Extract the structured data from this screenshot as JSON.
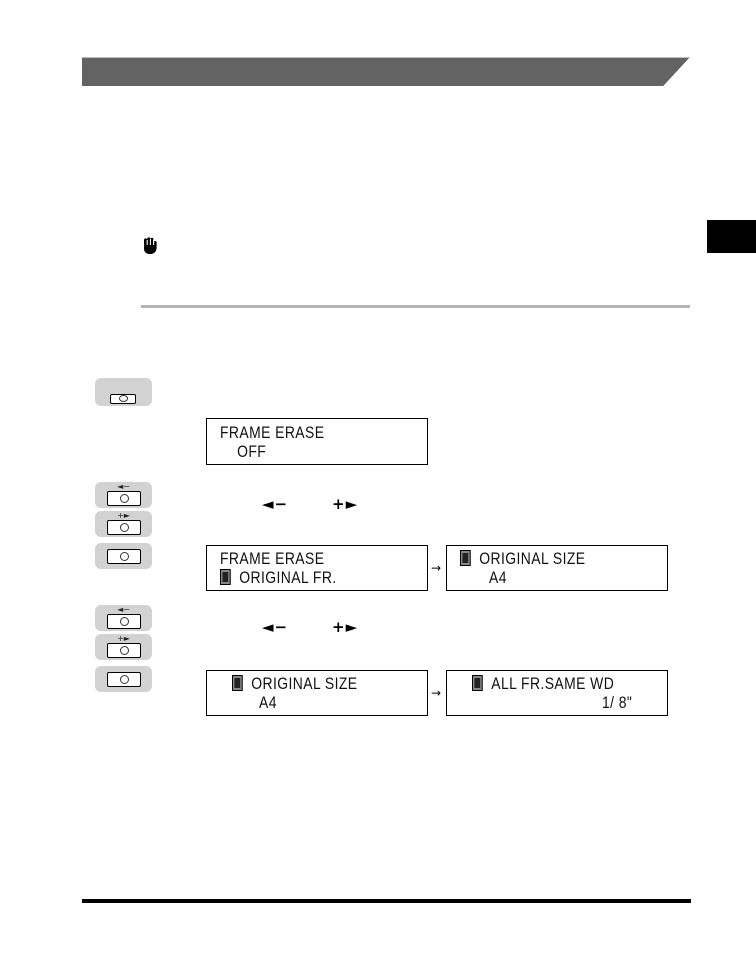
{
  "header": {
    "title": ""
  },
  "chapter_tab": {
    "label": ""
  },
  "notice": {
    "icon": "important-hand-icon"
  },
  "steps": [
    {
      "key": {
        "name": "special-features-key",
        "label": ""
      },
      "display": {
        "line1": "FRAME ERASE",
        "line2": "    OFF"
      }
    },
    {
      "keys": [
        {
          "name": "left-minus-key",
          "label": "◄−"
        },
        {
          "name": "plus-right-key",
          "label": "+►"
        },
        {
          "name": "ok-key",
          "label": ""
        }
      ],
      "inline_keys": {
        "left": "◄−",
        "right": "+►"
      },
      "displays": [
        {
          "line1": "FRAME ERASE",
          "line2": "ORIGINAL FR.",
          "has_pattern_line2": true
        },
        {
          "line1": "ORIGINAL SIZE",
          "line2": "A4",
          "has_pattern_line1": true
        }
      ],
      "arrow": "→"
    },
    {
      "keys": [
        {
          "name": "left-minus-key",
          "label": "◄−"
        },
        {
          "name": "plus-right-key",
          "label": "+►"
        },
        {
          "name": "ok-key",
          "label": ""
        }
      ],
      "inline_keys": {
        "left": "◄−",
        "right": "+►"
      },
      "displays": [
        {
          "line1": "ORIGINAL SIZE",
          "line2": "A4",
          "has_pattern_line1": true
        },
        {
          "line1": "ALL FR.SAME WD",
          "line2": "1/ 8\"",
          "has_pattern_line1": true
        }
      ],
      "arrow": "→"
    }
  ]
}
